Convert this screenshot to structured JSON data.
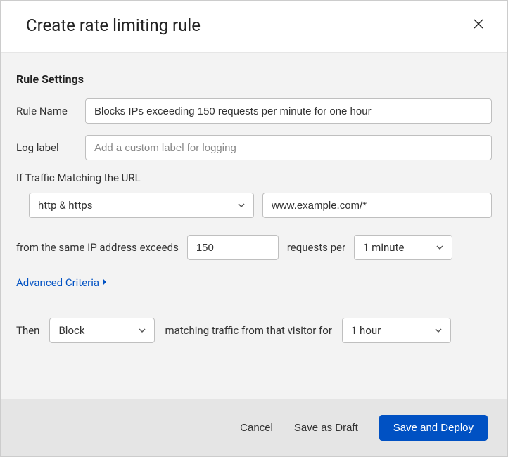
{
  "dialog": {
    "title": "Create rate limiting rule"
  },
  "settings": {
    "heading": "Rule Settings",
    "rule_name_label": "Rule Name",
    "rule_name_value": "Blocks IPs exceeding 150 requests per minute for one hour",
    "log_label_label": "Log label",
    "log_label_placeholder": "Add a custom label for logging",
    "log_label_value": ""
  },
  "matching": {
    "url_label": "If Traffic Matching the URL",
    "scheme_selected": "http & https",
    "url_value": "www.example.com/*",
    "threshold_prefix": "from the same IP address exceeds",
    "threshold_value": "150",
    "threshold_mid": "requests per",
    "period_selected": "1 minute",
    "advanced_label": "Advanced Criteria"
  },
  "action": {
    "then_label": "Then",
    "action_selected": "Block",
    "mid_text": "matching traffic from that visitor for",
    "duration_selected": "1 hour"
  },
  "footer": {
    "cancel": "Cancel",
    "draft": "Save as Draft",
    "deploy": "Save and Deploy"
  }
}
